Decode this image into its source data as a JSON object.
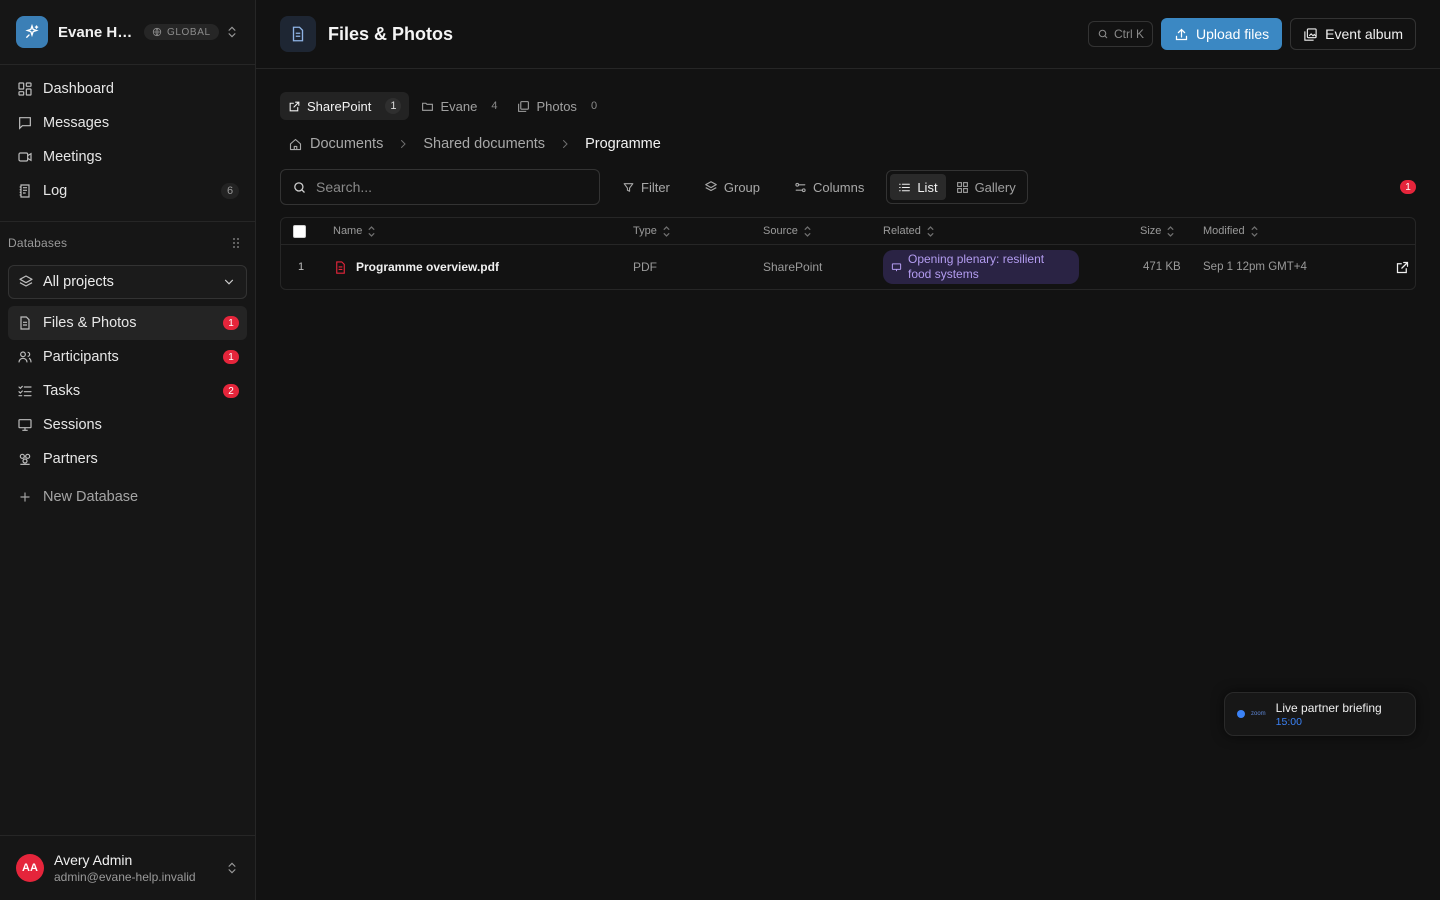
{
  "colors": {
    "accent": "#3b88c3",
    "danger": "#e5253b",
    "related_chip_bg": "#2a2344",
    "related_chip_text": "#b39cf0"
  },
  "workspace": {
    "name": "Evane He...",
    "badge": "GLOBAL"
  },
  "nav": {
    "items": [
      {
        "label": "Dashboard",
        "icon": "dashboard-icon"
      },
      {
        "label": "Messages",
        "icon": "message-icon"
      },
      {
        "label": "Meetings",
        "icon": "video-icon"
      },
      {
        "label": "Log",
        "icon": "log-icon",
        "count": "6"
      }
    ]
  },
  "databases": {
    "heading": "Databases",
    "project_select": "All projects",
    "items": [
      {
        "label": "Files & Photos",
        "badge": "1",
        "icon": "file-icon"
      },
      {
        "label": "Participants",
        "badge": "1",
        "icon": "users-icon"
      },
      {
        "label": "Tasks",
        "badge": "2",
        "icon": "tasks-icon"
      },
      {
        "label": "Sessions",
        "icon": "presentation-icon"
      },
      {
        "label": "Partners",
        "icon": "handshake-icon"
      }
    ],
    "new_label": "New Database"
  },
  "user": {
    "initials": "AA",
    "name": "Avery Admin",
    "email": "admin@evane-help.invalid"
  },
  "header": {
    "title": "Files & Photos",
    "shortcut": "Ctrl K",
    "upload_label": "Upload files",
    "album_label": "Event album"
  },
  "source_tabs": [
    {
      "label": "SharePoint",
      "count": "1"
    },
    {
      "label": "Evane",
      "count": "4"
    },
    {
      "label": "Photos",
      "count": "0"
    }
  ],
  "breadcrumb": [
    "Documents",
    "Shared documents",
    "Programme"
  ],
  "toolbar": {
    "search_placeholder": "Search...",
    "filter": "Filter",
    "group": "Group",
    "columns": "Columns",
    "list": "List",
    "gallery": "Gallery",
    "alert_count": "1"
  },
  "table": {
    "columns": [
      "Name",
      "Type",
      "Source",
      "Related",
      "Size",
      "Modified"
    ],
    "rows": [
      {
        "index": "1",
        "name": "Programme overview.pdf",
        "type": "PDF",
        "source": "SharePoint",
        "related_line1": "Opening plenary: resilient",
        "related_line2": "food systems",
        "size": "471 KB",
        "modified": "Sep 1 12pm GMT+4"
      }
    ]
  },
  "toast": {
    "zoom_label": "zoom",
    "title": "Live partner briefing",
    "time": "15:00"
  }
}
